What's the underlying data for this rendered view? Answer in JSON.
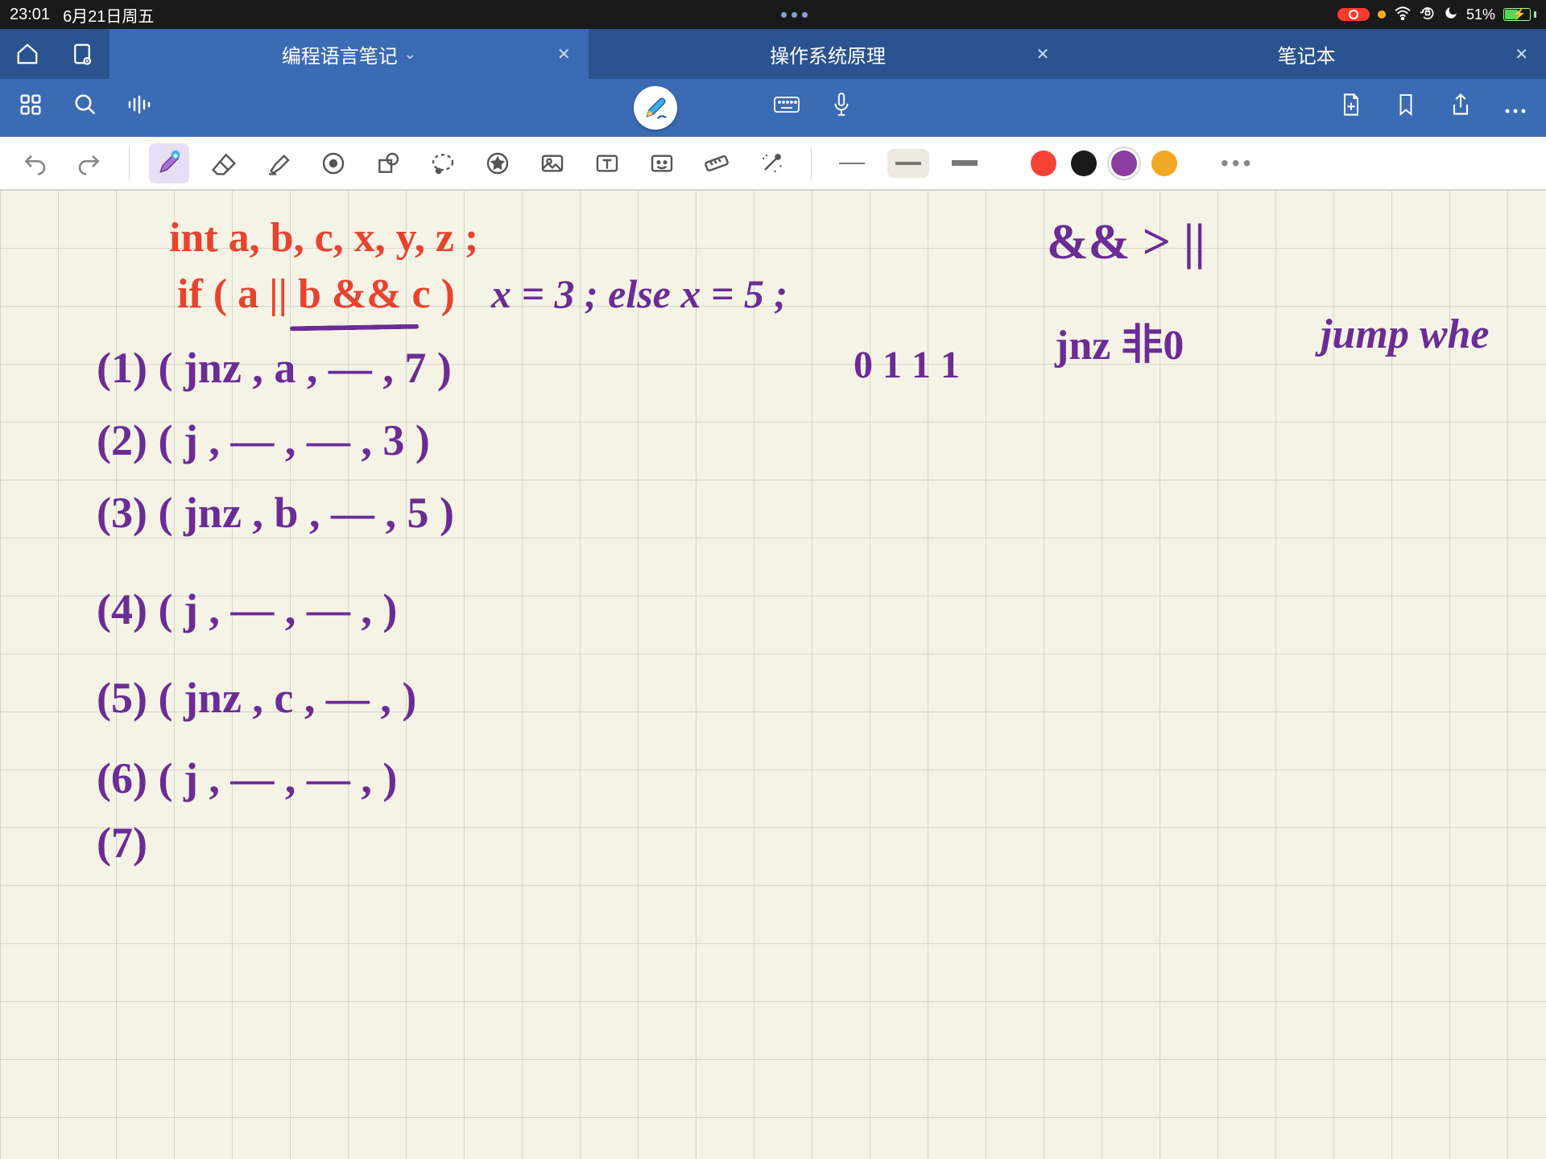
{
  "status": {
    "time": "23:01",
    "date": "6月21日周五",
    "battery_pct": "51%"
  },
  "tabs": {
    "active": "编程语言笔记",
    "tab2": "操作系统原理",
    "tab3": "笔记本"
  },
  "colors": {
    "red": "#f44336",
    "black": "#1a1a1a",
    "purple": "#8a3fa0",
    "orange": "#f2a825"
  },
  "handwriting": {
    "line1": "int a, b, c, x, y, z ;",
    "line2a": "if ( a || b && c )",
    "line2b": "x = 3 ;  else x = 5 ;",
    "annot_prec": "&& > ||",
    "annot_jnz": "jnz 非0",
    "annot_jump": "jump whe",
    "annot_bits": "0 1 1 1",
    "q1": "(1)   ( jnz ,  a ,  — ,   7  )",
    "q2": "(2)   (  j  ,  —  ,  —  ,   3  )",
    "q3": "(3)   ( jnz ,  b ,  — ,   5  )",
    "q4": "(4)   (  j  ,  —  ,  —  ,        )",
    "q5": "(5)   ( jnz ,  c ,  — ,        )",
    "q6": "(6)   (  j  ,  —  ,  —  ,        )",
    "q7": "(7)"
  }
}
